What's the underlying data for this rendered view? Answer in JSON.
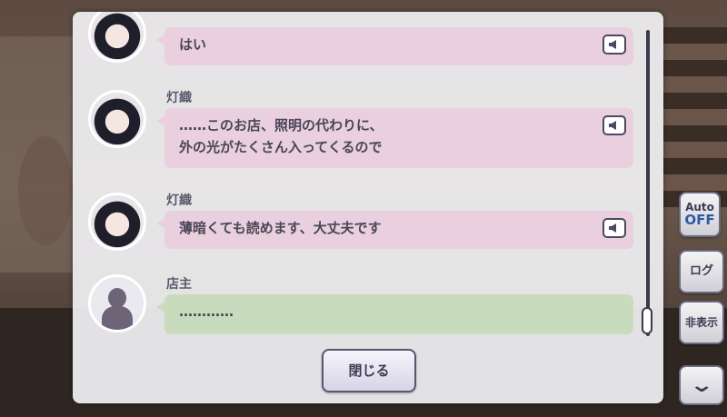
{
  "side_buttons": {
    "auto_label": "Auto",
    "auto_state": "OFF",
    "log_label": "ログ",
    "hide_label": "非表示"
  },
  "log": {
    "entries": [
      {
        "speaker": "",
        "text": "はい",
        "color": "#ead0df"
      },
      {
        "speaker": "灯織",
        "line1": "……このお店、照明の代わりに、",
        "line2": "外の光がたくさん入ってくるので",
        "color": "#ead0df"
      },
      {
        "speaker": "灯織",
        "text": "薄暗くても読めます、大丈夫です",
        "color": "#ead0df"
      },
      {
        "speaker": "店主",
        "text": "…………",
        "color": "#c9dbbd"
      }
    ],
    "close_label": "閉じる"
  },
  "colors": {
    "pink_bubble": "#ead0df",
    "green_bubble": "#c9dbbd",
    "auto_off": "#2f5aa8"
  }
}
